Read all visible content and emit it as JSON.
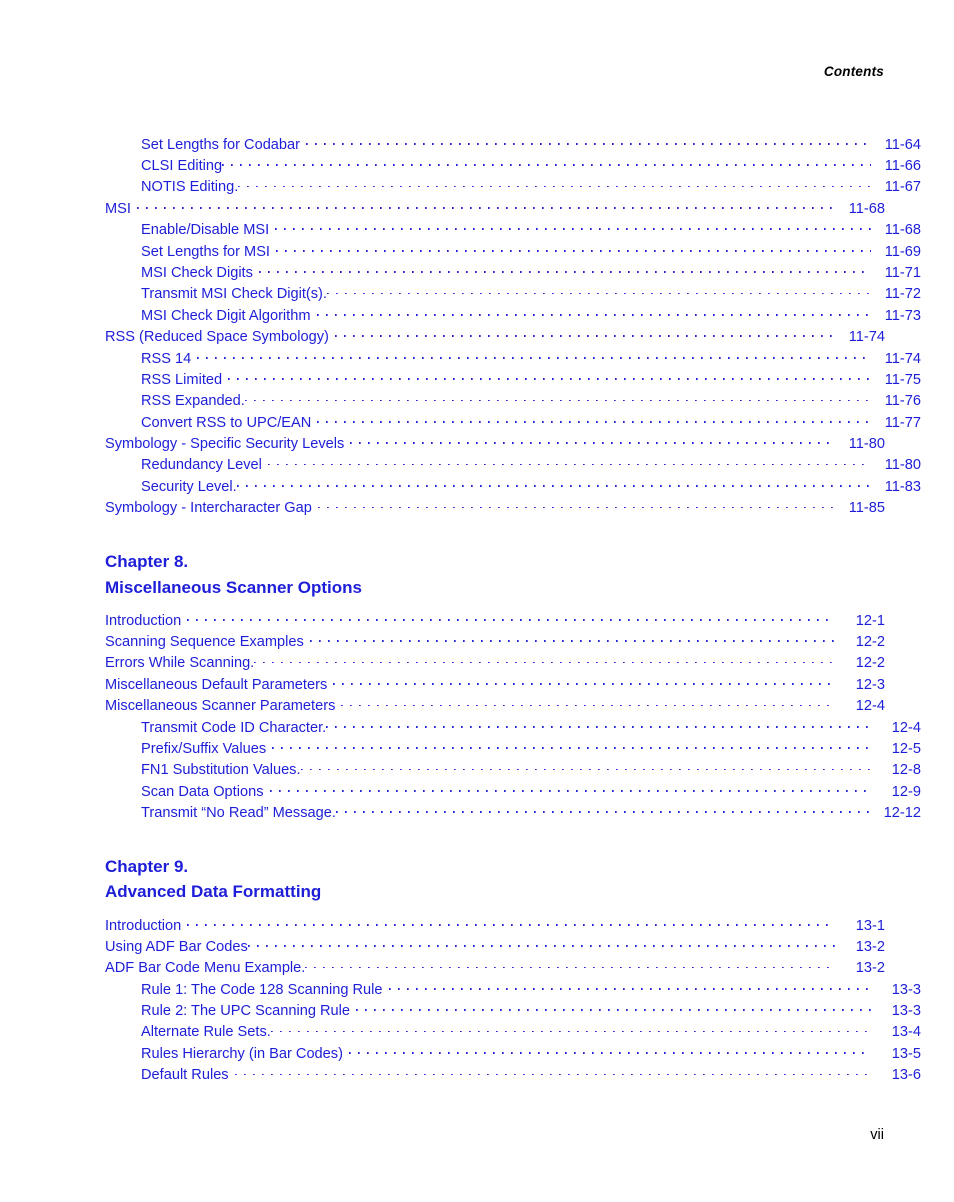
{
  "page": {
    "running_header": "Contents",
    "folio": "vii"
  },
  "toc": [
    {
      "kind": "entry",
      "level": 2,
      "title": "Set Lengths for Codabar",
      "gap": "normal",
      "page": "11-64"
    },
    {
      "kind": "entry",
      "level": 2,
      "title": "CLSI Editing",
      "gap": "tight",
      "page": "11-66"
    },
    {
      "kind": "entry",
      "level": 2,
      "title": "NOTIS Editing.",
      "gap": "tight",
      "page": "11-67"
    },
    {
      "kind": "entry",
      "level": 1,
      "title": "MSI",
      "gap": "normal",
      "page": "11-68"
    },
    {
      "kind": "entry",
      "level": 2,
      "title": "Enable/Disable MSI",
      "gap": "normal",
      "page": "11-68"
    },
    {
      "kind": "entry",
      "level": 2,
      "title": "Set Lengths for MSI",
      "gap": "normal",
      "page": "11-69"
    },
    {
      "kind": "entry",
      "level": 2,
      "title": "MSI Check Digits",
      "gap": "normal",
      "page": "11-71"
    },
    {
      "kind": "entry",
      "level": 2,
      "title": "Transmit MSI Check Digit(s).",
      "gap": "tight",
      "page": "11-72"
    },
    {
      "kind": "entry",
      "level": 2,
      "title": "MSI Check Digit Algorithm",
      "gap": "normal",
      "page": "11-73"
    },
    {
      "kind": "entry",
      "level": 1,
      "title": "RSS (Reduced Space Symbology)",
      "gap": "normal",
      "page": "11-74"
    },
    {
      "kind": "entry",
      "level": 2,
      "title": "RSS 14",
      "gap": "normal",
      "page": "11-74"
    },
    {
      "kind": "entry",
      "level": 2,
      "title": "RSS Limited",
      "gap": "normal",
      "page": "11-75"
    },
    {
      "kind": "entry",
      "level": 2,
      "title": "RSS Expanded.",
      "gap": "tight",
      "page": "11-76"
    },
    {
      "kind": "entry",
      "level": 2,
      "title": "Convert RSS to UPC/EAN",
      "gap": "normal",
      "page": "11-77"
    },
    {
      "kind": "entry",
      "level": 1,
      "title": "Symbology - Specific Security Levels",
      "gap": "normal",
      "page": "11-80"
    },
    {
      "kind": "entry",
      "level": 2,
      "title": "Redundancy Level",
      "gap": "normal",
      "page": "11-80"
    },
    {
      "kind": "entry",
      "level": 2,
      "title": "Security Level.",
      "gap": "tight",
      "page": "11-83"
    },
    {
      "kind": "entry",
      "level": 1,
      "title": "Symbology - Intercharacter Gap",
      "gap": "normal",
      "page": "11-85"
    },
    {
      "kind": "chapter",
      "line1": "Chapter 8.",
      "line2": "Miscellaneous Scanner Options"
    },
    {
      "kind": "entry",
      "level": 1,
      "title": "Introduction",
      "gap": "normal",
      "page": "12-1"
    },
    {
      "kind": "entry",
      "level": 1,
      "title": "Scanning Sequence Examples",
      "gap": "normal",
      "page": "12-2"
    },
    {
      "kind": "entry",
      "level": 1,
      "title": "Errors While Scanning.",
      "gap": "tight",
      "page": "12-2"
    },
    {
      "kind": "entry",
      "level": 1,
      "title": "Miscellaneous Default Parameters",
      "gap": "normal",
      "page": "12-3"
    },
    {
      "kind": "entry",
      "level": 1,
      "title": "Miscellaneous Scanner Parameters",
      "gap": "normal",
      "page": "12-4"
    },
    {
      "kind": "entry",
      "level": 2,
      "title": "Transmit Code ID Character.",
      "gap": "tight",
      "page": "12-4"
    },
    {
      "kind": "entry",
      "level": 2,
      "title": "Prefix/Suffix Values",
      "gap": "normal",
      "page": "12-5"
    },
    {
      "kind": "entry",
      "level": 2,
      "title": "FN1 Substitution Values.",
      "gap": "tight",
      "page": "12-8"
    },
    {
      "kind": "entry",
      "level": 2,
      "title": "Scan Data Options",
      "gap": "normal",
      "page": "12-9"
    },
    {
      "kind": "entry",
      "level": 2,
      "title": "Transmit “No Read” Message.",
      "gap": "tight",
      "page": "12-12"
    },
    {
      "kind": "chapter",
      "line1": "Chapter 9.",
      "line2": "Advanced Data Formatting"
    },
    {
      "kind": "entry",
      "level": 1,
      "title": "Introduction",
      "gap": "normal",
      "page": "13-1"
    },
    {
      "kind": "entry",
      "level": 1,
      "title": "Using ADF Bar Codes",
      "gap": "tight",
      "page": "13-2"
    },
    {
      "kind": "entry",
      "level": 1,
      "title": "ADF Bar Code Menu Example.",
      "gap": "tight",
      "page": "13-2"
    },
    {
      "kind": "entry",
      "level": 2,
      "title": "Rule 1: The Code 128 Scanning Rule",
      "gap": "normal",
      "page": "13-3"
    },
    {
      "kind": "entry",
      "level": 2,
      "title": "Rule 2: The UPC Scanning Rule",
      "gap": "normal",
      "page": "13-3"
    },
    {
      "kind": "entry",
      "level": 2,
      "title": "Alternate Rule Sets.",
      "gap": "tight",
      "page": "13-4"
    },
    {
      "kind": "entry",
      "level": 2,
      "title": "Rules Hierarchy (in Bar Codes)",
      "gap": "normal",
      "page": "13-5"
    },
    {
      "kind": "entry",
      "level": 2,
      "title": "Default Rules",
      "gap": "normal",
      "page": "13-6"
    }
  ],
  "colors": {
    "link_blue": "#1e1ed8",
    "text_black": "#000000",
    "page_background": "#ffffff"
  }
}
